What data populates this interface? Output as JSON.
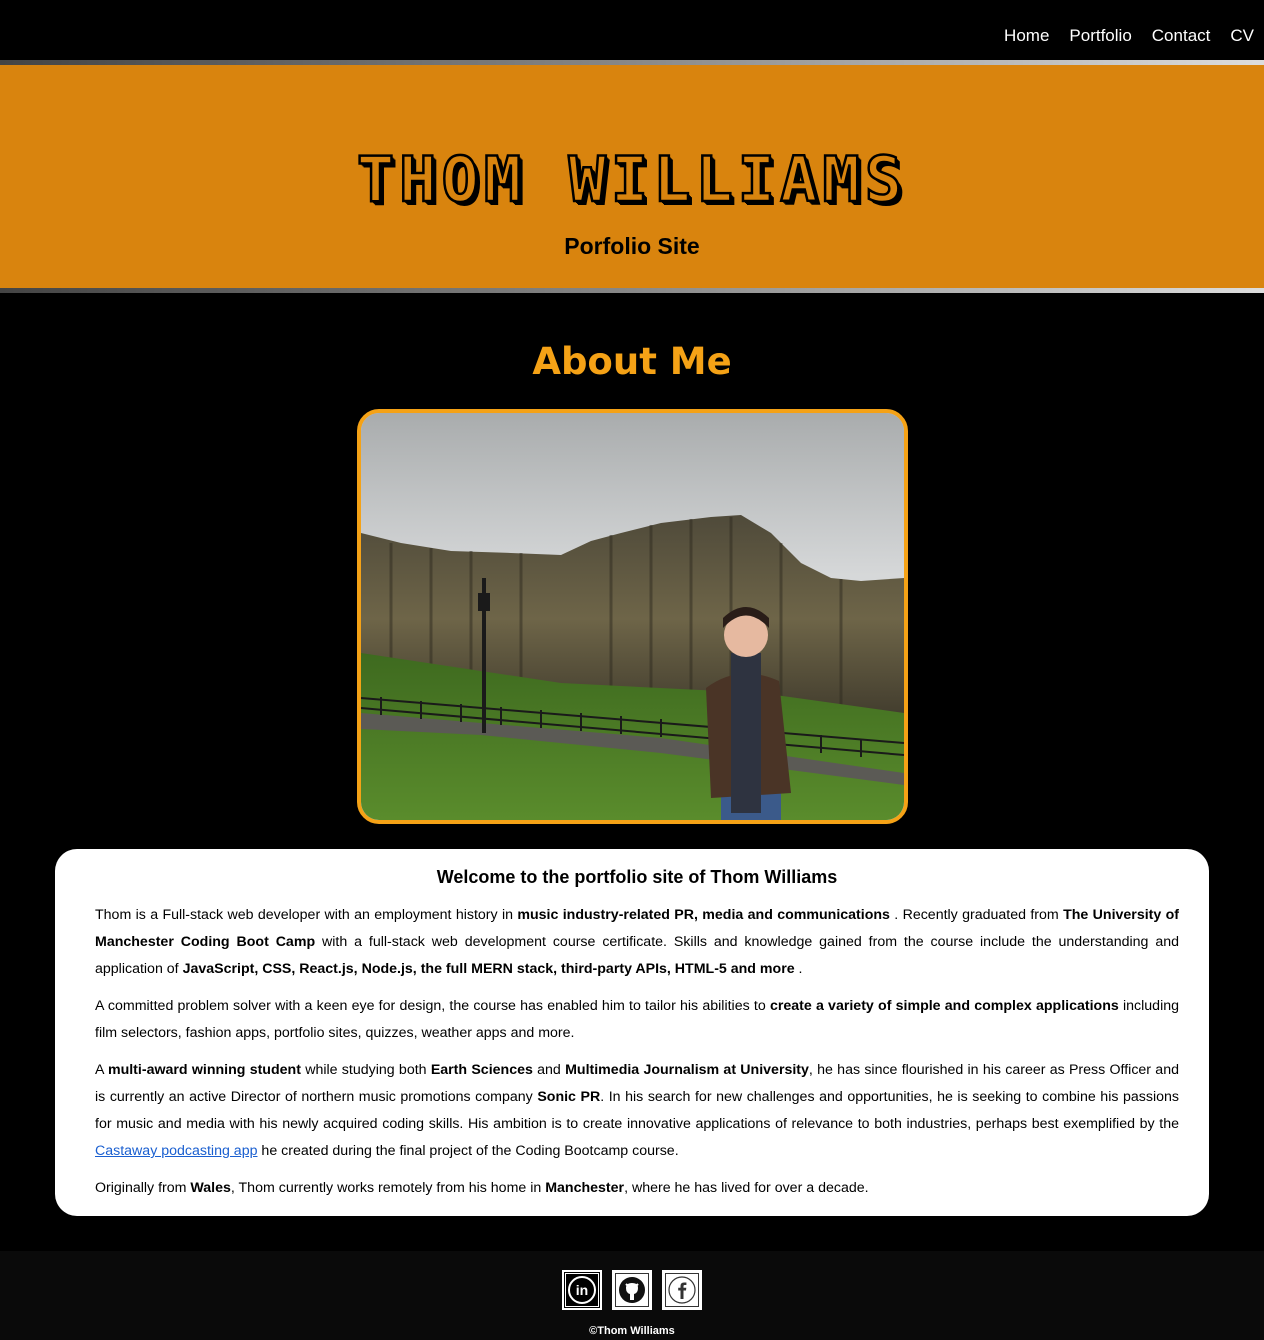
{
  "nav": {
    "items": [
      {
        "label": "Home"
      },
      {
        "label": "Portfolio"
      },
      {
        "label": "Contact"
      },
      {
        "label": "CV"
      }
    ]
  },
  "hero": {
    "title": "THOM WILLIAMS",
    "subtitle": "Porfolio Site"
  },
  "about": {
    "heading": "About Me",
    "card_title": "Welcome to the portfolio site of Thom Williams",
    "p1": [
      {
        "t": "Thom is a Full-stack web developer with an employment history in "
      },
      {
        "t": "music industry-related PR, media and communications",
        "b": true
      },
      {
        "t": " . Recently graduated from "
      },
      {
        "t": "The University of Manchester Coding Boot Camp",
        "b": true
      },
      {
        "t": " with a full-stack web development course certificate. Skills and knowledge gained from the course include the understanding and application of "
      },
      {
        "t": "JavaScript, CSS, React.js, Node.js, the full MERN stack, third-party APIs, HTML-5 and more",
        "b": true
      },
      {
        "t": " ."
      }
    ],
    "p2": [
      {
        "t": "A committed problem solver with a keen eye for design, the course has enabled him to tailor his abilities to "
      },
      {
        "t": "create a variety of simple and complex applications",
        "b": true
      },
      {
        "t": " including film selectors, fashion apps, portfolio sites, quizzes, weather apps and more."
      }
    ],
    "p3": [
      {
        "t": "A "
      },
      {
        "t": "multi-award winning student",
        "b": true
      },
      {
        "t": " while studying both "
      },
      {
        "t": "Earth Sciences",
        "b": true
      },
      {
        "t": " and "
      },
      {
        "t": "Multimedia Journalism at University",
        "b": true
      },
      {
        "t": ", he has since flourished in his career as Press Officer and is currently an active Director of northern music promotions company "
      },
      {
        "t": "Sonic PR",
        "b": true
      },
      {
        "t": ". In his search for new challenges and opportunities, he is seeking to combine his passions for music and media with his newly acquired coding skills. His ambition is to create innovative applications of relevance to both industries, perhaps best exemplified by the "
      },
      {
        "t": "Castaway podcasting app",
        "link": true
      },
      {
        "t": " he created during the final project of the Coding Bootcamp course."
      }
    ],
    "p4": [
      {
        "t": "Originally from "
      },
      {
        "t": "Wales",
        "b": true
      },
      {
        "t": ", Thom currently works remotely from his home in "
      },
      {
        "t": "Manchester",
        "b": true
      },
      {
        "t": ", where he has lived for over a decade."
      }
    ]
  },
  "footer": {
    "social": [
      {
        "icon": "linkedin-icon"
      },
      {
        "icon": "github-icon"
      },
      {
        "icon": "facebook-icon"
      }
    ],
    "copyright": "©Thom Williams"
  },
  "colors": {
    "accent": "#f5a216",
    "hero_bg": "#d9840e",
    "background": "#000000",
    "link": "#1a5fd0"
  }
}
